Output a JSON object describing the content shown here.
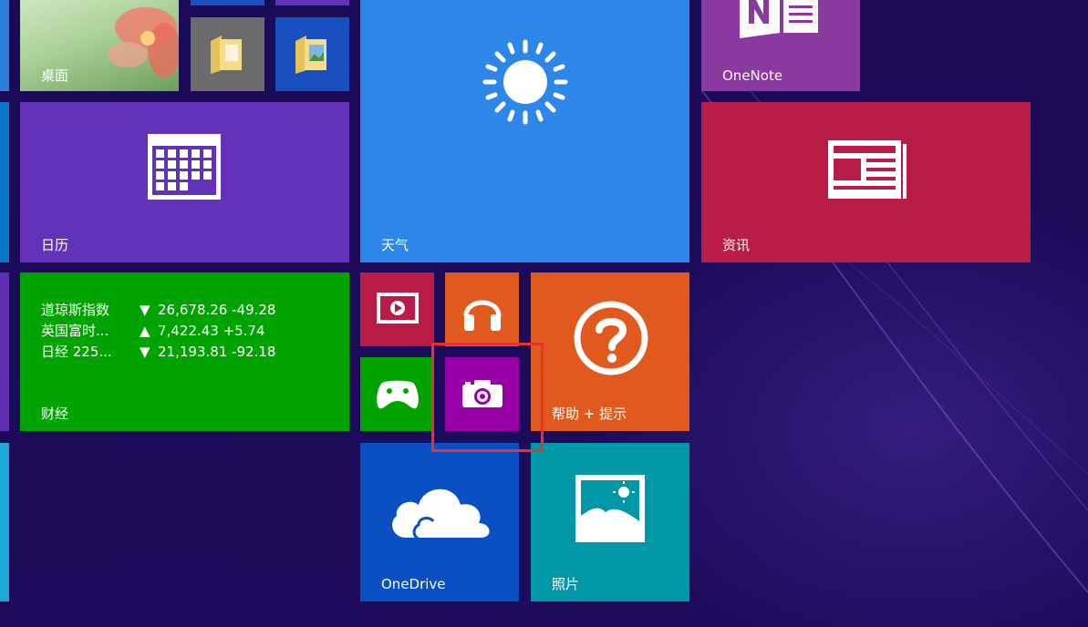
{
  "tiles": {
    "desktop": {
      "label": "桌面"
    },
    "calendar": {
      "label": "日历"
    },
    "weather": {
      "label": "天气"
    },
    "onenote": {
      "label": "OneNote"
    },
    "news": {
      "label": "资讯"
    },
    "finance": {
      "label": "财经",
      "rows": [
        {
          "name": "道琼斯指数",
          "direction": "▼",
          "value": "26,678.26 -49.28"
        },
        {
          "name": "英国富时...",
          "direction": "▲",
          "value": "7,422.43 +5.74"
        },
        {
          "name": "日经 225...",
          "direction": "▼",
          "value": "21,193.81 -92.18"
        }
      ]
    },
    "help": {
      "label": "帮助 + 提示"
    },
    "onedrive": {
      "label": "OneDrive"
    },
    "photos": {
      "label": "照片"
    }
  },
  "colors": {
    "background": "#1c0b57",
    "desktop": "#7fa86a",
    "file_explorer_1": "#6b6b6b",
    "file_explorer_2": "#1a4fc0",
    "calendar": "#6232b8",
    "weather": "#2d86e8",
    "onenote": "#8a3a9e",
    "news": "#b91d47",
    "finance": "#00a300",
    "video": "#b91d47",
    "music": "#e05a20",
    "games": "#00a300",
    "camera": "#9a00a8",
    "help": "#e05a20",
    "onedrive": "#0a50c4",
    "photos": "#0097a7",
    "highlight": "#e8322e"
  }
}
